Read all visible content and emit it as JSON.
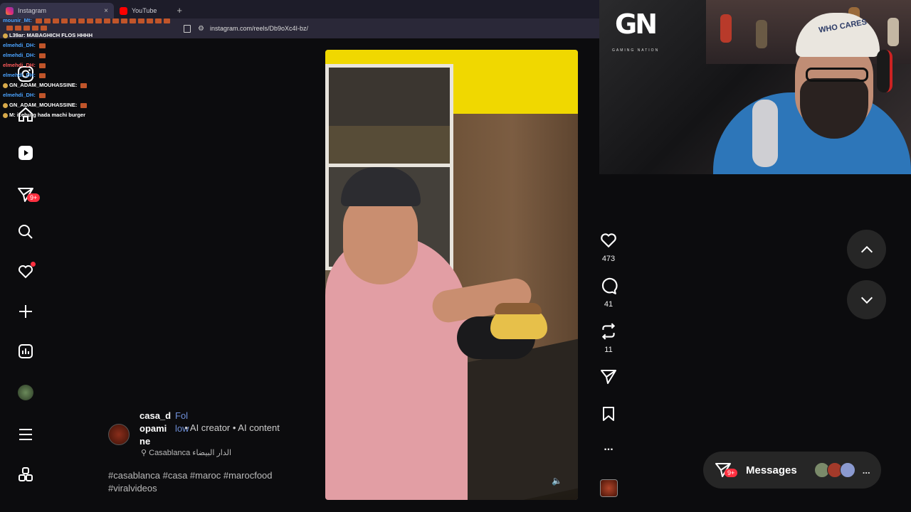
{
  "browser": {
    "tabs": [
      {
        "label": "Instagram",
        "active": true
      },
      {
        "label": "YouTube",
        "active": false
      }
    ],
    "new_tab": "+",
    "close": "×",
    "url": "instagram.com/reels/Db9oXc4I-bz/"
  },
  "chat": {
    "lines": [
      {
        "user": "mounir_Mt:",
        "msg": "",
        "emotes": 16,
        "color": "blue"
      },
      {
        "user": "",
        "msg": "",
        "emotes": 5,
        "color": "blue"
      },
      {
        "user": "L39ar:",
        "msg": "MABAGHICH FLOS HHHH",
        "emotes": 0,
        "color": "white"
      },
      {
        "user": "elmehdi_DH:",
        "msg": "",
        "emotes": 1,
        "color": "blue"
      },
      {
        "user": "elmehdi_DH:",
        "msg": "",
        "emotes": 1,
        "color": "blue"
      },
      {
        "user": "elmehdi_DH:",
        "msg": "",
        "emotes": 1,
        "color": "red"
      },
      {
        "user": "elmehdi_DH:",
        "msg": "",
        "emotes": 1,
        "color": "blue"
      },
      {
        "user": "GN_ADAM_MOUHASSINE:",
        "msg": "",
        "emotes": 1,
        "color": "white"
      },
      {
        "user": "elmehdi_DH:",
        "msg": "",
        "emotes": 1,
        "color": "blue"
      },
      {
        "user": "GN_ADAM_MOUHASSINE:",
        "msg": "",
        "emotes": 1,
        "color": "white"
      },
      {
        "user": "M:",
        "msg": "iceburg hada machi burger",
        "emotes": 0,
        "color": "white"
      }
    ]
  },
  "sidebar": {
    "notifications_badge": "9+",
    "items": [
      "instagram-logo",
      "home",
      "reels",
      "messages",
      "search",
      "notifications",
      "create",
      "dashboard",
      "profile",
      "more",
      "threads"
    ]
  },
  "reel": {
    "author": "casa_dopamine",
    "follow": "Follow",
    "meta": "• AI creator • AI content",
    "location": "Casablanca الدار البيضاء",
    "hashtags": "#casablanca #casa #maroc #marocfood #viralvideos",
    "likes": "473",
    "comments": "41",
    "reposts": "11",
    "more": "..."
  },
  "messages": {
    "label": "Messages",
    "badge": "9+",
    "more": "..."
  },
  "webcam": {
    "logo": "GN",
    "logo_sub": "GAMING NATION",
    "hat_text": "WHO CARES"
  },
  "colors": {
    "accent": "#ff3040",
    "link": "#6f8fd8",
    "background": "#0c0c0e"
  }
}
